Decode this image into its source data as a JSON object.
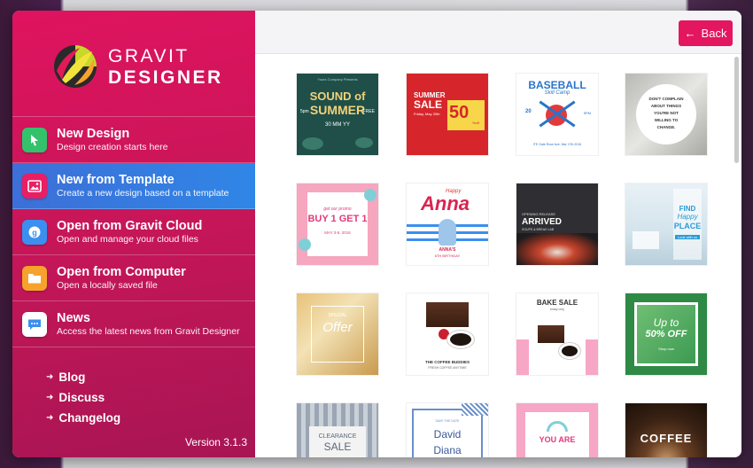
{
  "logo": {
    "line1": "GRAVIT",
    "line2": "DESIGNER"
  },
  "menu": [
    {
      "title": "New Design",
      "subtitle": "Design creation starts here",
      "icon": "cursor-icon",
      "color": "#33c26b"
    },
    {
      "title": "New from Template",
      "subtitle": "Create a new design based on a template",
      "icon": "image-icon",
      "color": "#e91e63"
    },
    {
      "title": "Open from Gravit Cloud",
      "subtitle": "Open and manage your cloud files",
      "icon": "cloud-icon",
      "color": "#3b8fef"
    },
    {
      "title": "Open from Computer",
      "subtitle": "Open a locally saved file",
      "icon": "folder-icon",
      "color": "#f7a22c"
    },
    {
      "title": "News",
      "subtitle": "Access the latest news from Gravit Designer",
      "icon": "chat-icon",
      "color": "#ffffff"
    }
  ],
  "links": [
    "Blog",
    "Discuss",
    "Changelog"
  ],
  "version": "Version 3.1.3",
  "back_label": "Back",
  "accent": "#e3165f",
  "templates": {
    "t1": {
      "l1": "SOUND of",
      "l2": "SUMMER",
      "l3": "30 MM YY",
      "top": "Yours Company Presents",
      "side1": "5pm",
      "side2": "FREE"
    },
    "t2": {
      "l1": "SUMMER",
      "l2": "SALE",
      "l3": "50",
      "l4": "%off",
      "small": "Friday, May 20th"
    },
    "t3": {
      "l1": "BASEBALL",
      "l2": "Skill Camp",
      "l3": "20",
      "l4": "5PM",
      "small": "ITE Gate Rose Ave. Mar 17th 2016"
    },
    "t4": {
      "l1": "DON'T COMPLAIN",
      "l2": "ABOUT THINGS",
      "l3": "YOU'RE NOT",
      "l4": "WILLING TO",
      "l5": "CHANGE."
    },
    "t5": {
      "l1": "get our promo",
      "l2": "BUY 1 GET 1",
      "l3": "MAY 3-6, 2016"
    },
    "t6": {
      "l1": "Happy",
      "l2": "Anna",
      "l3": "ANNA'S",
      "l4": "6TH BIRTHDAY"
    },
    "t7": {
      "l1": "OPENING RELEASE",
      "l2": "ARRIVED",
      "l3": "SOUPS & BREAD LAB"
    },
    "t8": {
      "l1": "FIND",
      "l2": "Happy",
      "l3": "PLACE",
      "l4": "Look with us"
    },
    "t9": {
      "l1": "SPECIAL",
      "l2": "Offer"
    },
    "t10": {
      "l1": "THE COFFEE BUDDIES",
      "l2": "FRESH COFFEE ANYTIME"
    },
    "t11": {
      "l1": "BAKE SALE",
      "l2": "today only"
    },
    "t12": {
      "l1": "Up to",
      "l2": "50% OFF",
      "l3": "Shop now"
    },
    "t13": {
      "l1": "CLEARANCE",
      "l2": "SALE"
    },
    "t14": {
      "l1": "David",
      "l2": "Diana",
      "l3": "SAVE THE DATE"
    },
    "t15": {
      "l1": "YOU ARE"
    },
    "t16": {
      "l1": "COFFEE"
    }
  }
}
